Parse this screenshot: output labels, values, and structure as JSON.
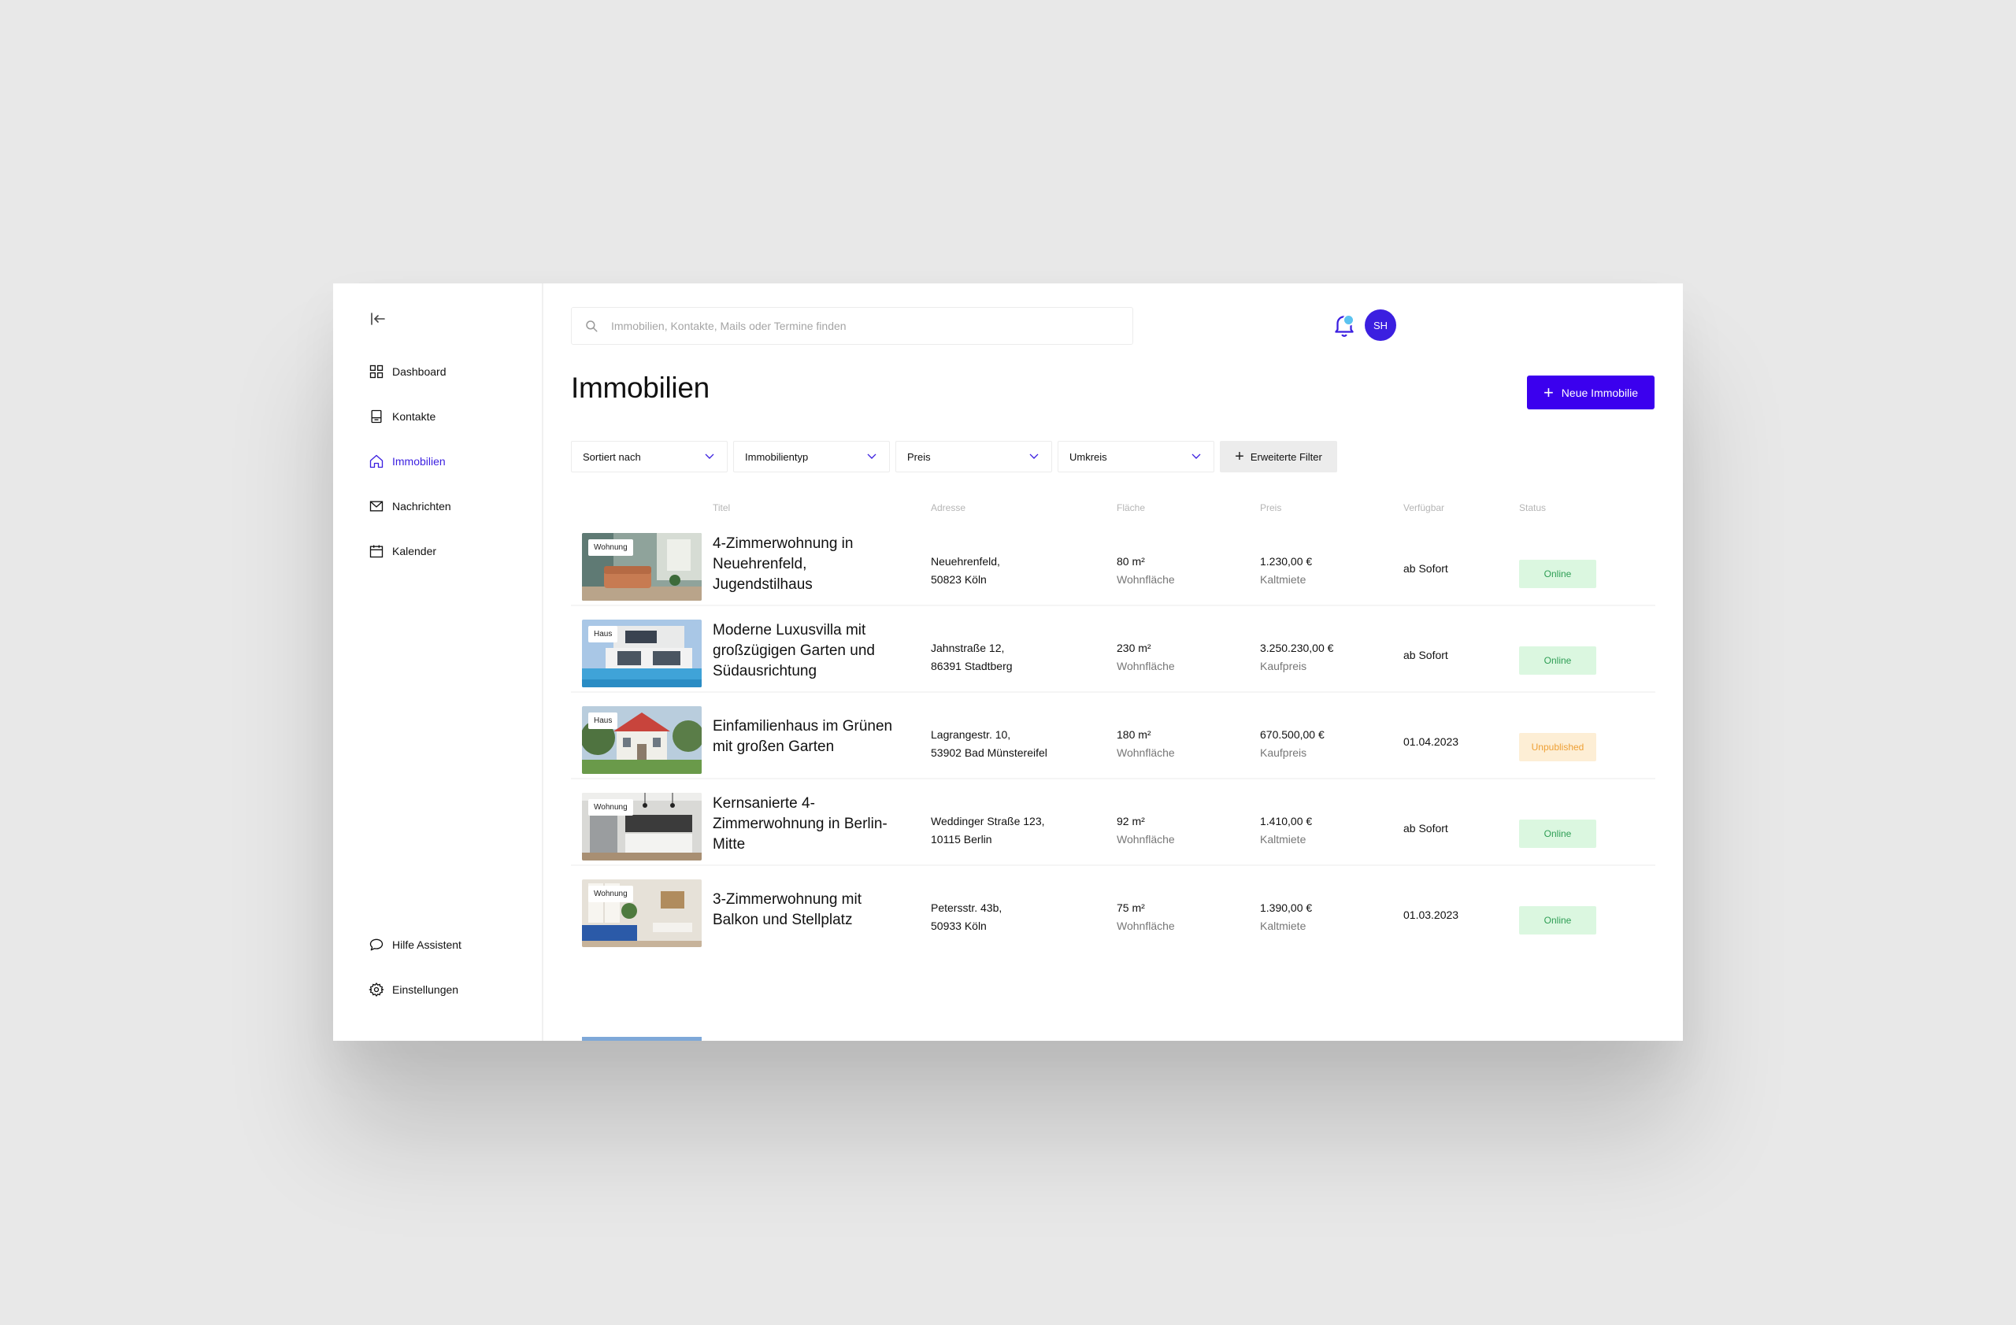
{
  "sidebar": {
    "nav": [
      {
        "label": "Dashboard",
        "icon": "grid-icon"
      },
      {
        "label": "Kontakte",
        "icon": "contacts-book-icon"
      },
      {
        "label": "Immobilien",
        "icon": "home-icon"
      },
      {
        "label": "Nachrichten",
        "icon": "mail-icon"
      },
      {
        "label": "Kalender",
        "icon": "calendar-icon"
      }
    ],
    "bottom": [
      {
        "label": "Hilfe Assistent",
        "icon": "chat-bubble-icon"
      },
      {
        "label": "Einstellungen",
        "icon": "gear-icon"
      }
    ]
  },
  "header": {
    "search_placeholder": "Immobilien, Kontakte, Mails oder Termine finden",
    "avatar_initials": "SH"
  },
  "page": {
    "title": "Immobilien",
    "new_button": "Neue Immobilie"
  },
  "filters": [
    "Sortiert nach",
    "Immobilientyp",
    "Preis",
    "Umkreis"
  ],
  "filter_more": "Erweiterte Filter",
  "columns": {
    "title": "Titel",
    "address": "Adresse",
    "area": "Fläche",
    "price": "Preis",
    "available": "Verfügbar",
    "status": "Status"
  },
  "rows": [
    {
      "tag": "Wohnung",
      "title": "4-Zimmerwohnung in Neuehrenfeld, Jugendstilhaus",
      "address_line1": "Neuehrenfeld,",
      "address_line2": "50823 Köln",
      "area": "80 m²",
      "area_label": "Wohnfläche",
      "price": "1.230,00 €",
      "price_label": "Kaltmiete",
      "available": "ab Sofort",
      "status": "Online"
    },
    {
      "tag": "Haus",
      "title": "Moderne Luxusvilla mit großzügigen Garten und Südausrichtung",
      "address_line1": "Jahnstraße 12,",
      "address_line2": "86391 Stadtberg",
      "area": "230 m²",
      "area_label": "Wohnfläche",
      "price": "3.250.230,00 €",
      "price_label": "Kaufpreis",
      "available": "ab Sofort",
      "status": "Online"
    },
    {
      "tag": "Haus",
      "title": "Einfamilienhaus im Grünen mit großen Garten",
      "address_line1": "Lagrangestr. 10,",
      "address_line2": "53902 Bad Münstereifel",
      "area": "180 m²",
      "area_label": "Wohnfläche",
      "price": "670.500,00 €",
      "price_label": "Kaufpreis",
      "available": "01.04.2023",
      "status": "Unpublished"
    },
    {
      "tag": "Wohnung",
      "title": "Kernsanierte 4-Zimmerwohnung in Berlin-Mitte",
      "address_line1": "Weddinger Straße 123,",
      "address_line2": "10115 Berlin",
      "area": "92 m²",
      "area_label": "Wohnfläche",
      "price": "1.410,00 €",
      "price_label": "Kaltmiete",
      "available": "ab Sofort",
      "status": "Online"
    },
    {
      "tag": "Wohnung",
      "title": "3-Zimmerwohnung mit Balkon und Stellplatz",
      "address_line1": "Petersstr. 43b,",
      "address_line2": "50933 Köln",
      "area": "75 m²",
      "area_label": "Wohnfläche",
      "price": "1.390,00 €",
      "price_label": "Kaltmiete",
      "available": "01.03.2023",
      "status": "Online"
    }
  ],
  "colors": {
    "accent": "#3b00ee",
    "online_bg": "#dbf7e0",
    "online_text": "#2f9e55",
    "unpublished_bg": "#fdeed5",
    "unpublished_text": "#eea036"
  }
}
